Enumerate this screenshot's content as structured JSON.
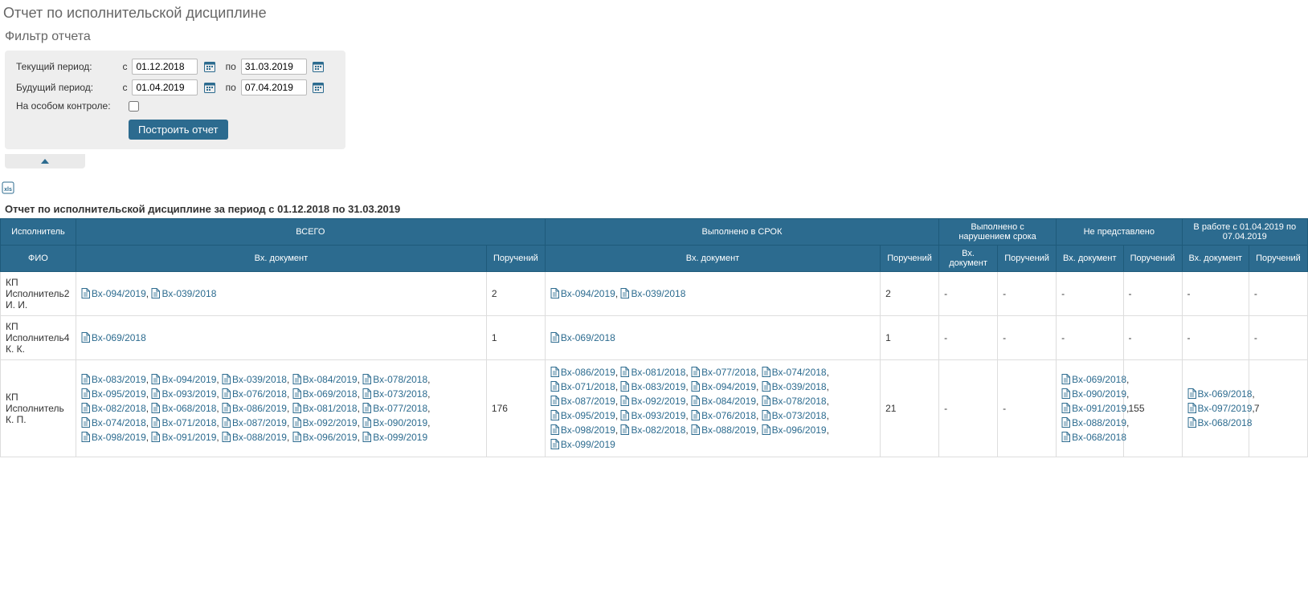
{
  "pageTitle": "Отчет по исполнительской дисциплине",
  "filter": {
    "title": "Фильтр отчета",
    "currentPeriodLabel": "Текущий период:",
    "futurePeriodLabel": "Будущий период:",
    "specialControlLabel": "На особом контроле:",
    "fromLabel": "с",
    "toLabel": "по",
    "currentFrom": "01.12.2018",
    "currentTo": "31.03.2019",
    "futureFrom": "01.04.2019",
    "futureTo": "07.04.2019",
    "buildButton": "Построить отчет"
  },
  "reportTitle": "Отчет по исполнительской дисциплине за период с 01.12.2018 по 31.03.2019",
  "headers": {
    "executor": "Исполнитель",
    "total": "ВСЕГО",
    "onTime": "Выполнено в СРОК",
    "late": "Выполнено с нарушением срока",
    "notSubmitted": "Не представлено",
    "inWork": "В работе с 01.04.2019 по 07.04.2019",
    "fio": "ФИО",
    "doc": "Вх. документ",
    "tasks": "Поручений"
  },
  "rows": [
    {
      "fio": "КП Исполнитель2 И. И.",
      "totalDocs": [
        "Вх-094/2019",
        "Вх-039/2018"
      ],
      "totalTasks": "2",
      "onTimeDocs": [
        "Вх-094/2019",
        "Вх-039/2018"
      ],
      "onTimeTasks": "2",
      "lateDocs": [],
      "lateTasks": "-",
      "notSubmittedDocs": [],
      "notSubmittedTasks": "-",
      "inWorkDocs": [],
      "inWorkTasks": "-"
    },
    {
      "fio": "КП Исполнитель4 К. К.",
      "totalDocs": [
        "Вх-069/2018"
      ],
      "totalTasks": "1",
      "onTimeDocs": [
        "Вх-069/2018"
      ],
      "onTimeTasks": "1",
      "lateDocs": [],
      "lateTasks": "-",
      "notSubmittedDocs": [],
      "notSubmittedTasks": "-",
      "inWorkDocs": [],
      "inWorkTasks": "-"
    },
    {
      "fio": "КП Исполнитель К. П.",
      "totalDocs": [
        "Вх-083/2019",
        "Вх-094/2019",
        "Вх-039/2018",
        "Вх-084/2019",
        "Вх-078/2018",
        "Вх-095/2019",
        "Вх-093/2019",
        "Вх-076/2018",
        "Вх-069/2018",
        "Вх-073/2018",
        "Вх-082/2018",
        "Вх-068/2018",
        "Вх-086/2019",
        "Вх-081/2018",
        "Вх-077/2018",
        "Вх-074/2018",
        "Вх-071/2018",
        "Вх-087/2019",
        "Вх-092/2019",
        "Вх-090/2019",
        "Вх-098/2019",
        "Вх-091/2019",
        "Вх-088/2019",
        "Вх-096/2019",
        "Вх-099/2019"
      ],
      "totalTasks": "176",
      "onTimeDocs": [
        "Вх-086/2019",
        "Вх-081/2018",
        "Вх-077/2018",
        "Вх-074/2018",
        "Вх-071/2018",
        "Вх-083/2019",
        "Вх-094/2019",
        "Вх-039/2018",
        "Вх-087/2019",
        "Вх-092/2019",
        "Вх-084/2019",
        "Вх-078/2018",
        "Вх-095/2019",
        "Вх-093/2019",
        "Вх-076/2018",
        "Вх-073/2018",
        "Вх-098/2019",
        "Вх-082/2018",
        "Вх-088/2019",
        "Вх-096/2019",
        "Вх-099/2019"
      ],
      "onTimeTasks": "21",
      "lateDocs": [],
      "lateTasks": "-",
      "notSubmittedDocs": [
        "Вх-069/2018",
        "Вх-090/2019",
        "Вх-091/2019",
        "Вх-088/2019",
        "Вх-068/2018"
      ],
      "notSubmittedTasks": "155",
      "inWorkDocs": [
        "Вх-069/2018",
        "Вх-097/2019",
        "Вх-068/2018"
      ],
      "inWorkTasks": "7"
    }
  ]
}
